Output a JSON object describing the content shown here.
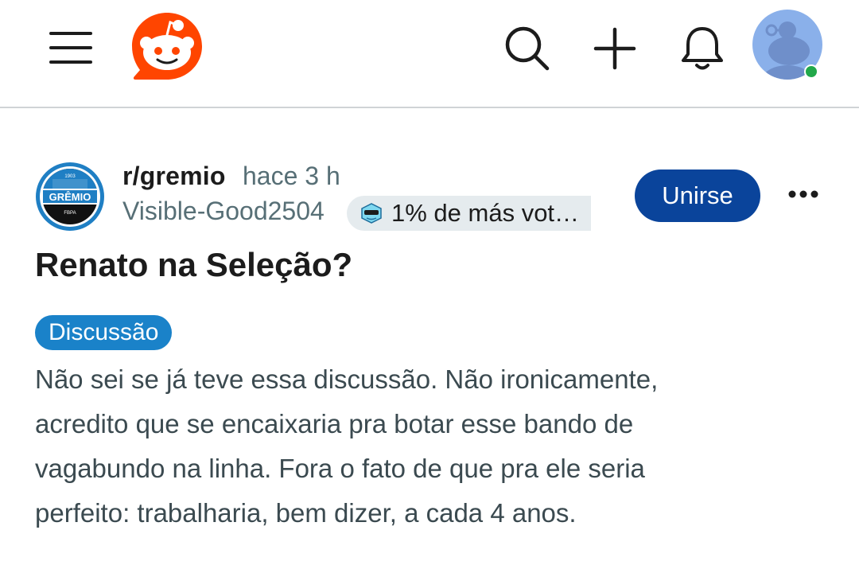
{
  "header": {
    "menu_icon": "hamburger-menu-icon",
    "logo_icon": "reddit-logo-icon",
    "search_icon": "search-icon",
    "create_icon": "plus-icon",
    "notifications_icon": "bell-icon",
    "avatar_icon": "user-avatar-icon",
    "online_status_color": "#22a84a"
  },
  "post": {
    "subreddit": "r/gremio",
    "time": "hace 3 h",
    "author": "Visible-Good2504",
    "author_flair": "1% de más vot…",
    "join_label": "Unirse",
    "more_icon": "more-options-icon",
    "title": "Renato na Seleção?",
    "tag": "Discussão",
    "tag_color": "#1a82c9",
    "body_lines": [
      "Não sei se já teve essa discussão. Não ironicamente,",
      "acredito que se encaixaria pra botar esse bando de",
      "vagabundo na linha. Fora o fato de que pra ele seria",
      "perfeito: trabalharia, bem dizer, a cada 4 anos."
    ],
    "subreddit_logo": {
      "year": "1903",
      "name": "GRÊMIO",
      "abbr": "FBPA"
    }
  },
  "colors": {
    "accent_blue": "#0a449b",
    "reddit_orange": "#ff4500"
  }
}
